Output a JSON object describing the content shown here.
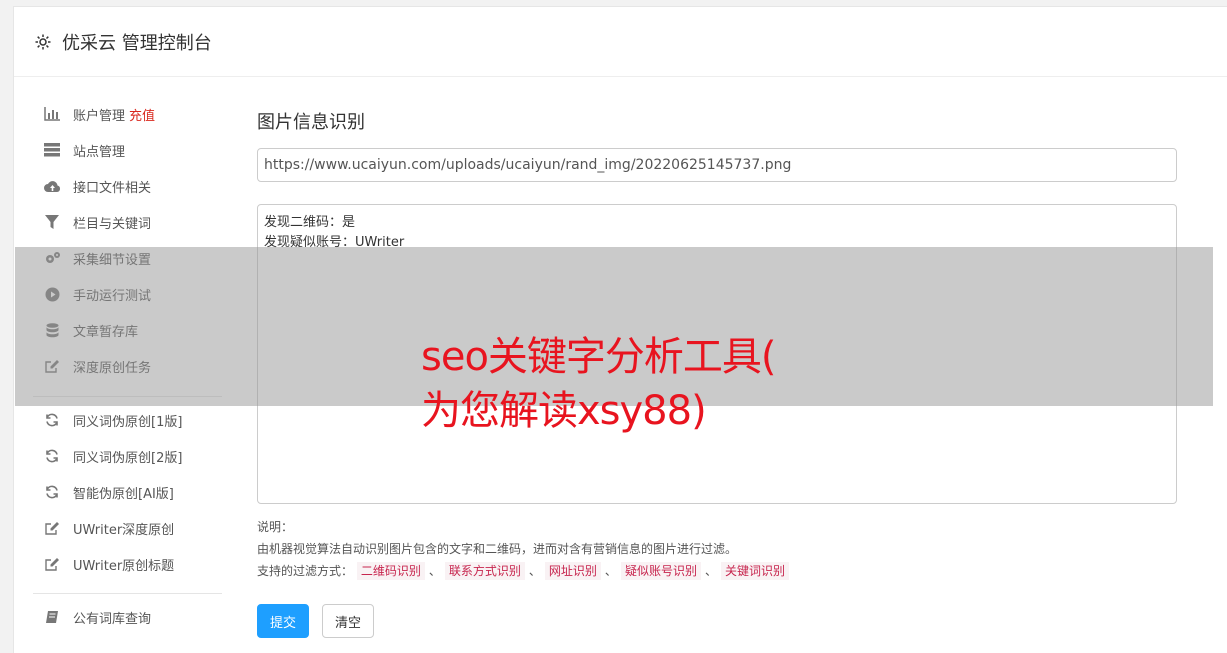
{
  "header": {
    "title": "优采云 管理控制台"
  },
  "sidebar": {
    "group1": [
      {
        "label": "账户管理",
        "badge": "充值",
        "icon": "bar-chart-icon"
      },
      {
        "label": "站点管理",
        "icon": "server-icon"
      },
      {
        "label": "接口文件相关",
        "icon": "cloud-upload-icon"
      },
      {
        "label": "栏目与关键词",
        "icon": "filter-icon"
      },
      {
        "label": "采集细节设置",
        "icon": "gears-icon"
      },
      {
        "label": "手动运行测试",
        "icon": "play-circle-icon"
      },
      {
        "label": "文章暂存库",
        "icon": "database-icon"
      },
      {
        "label": "深度原创任务",
        "icon": "edit-icon"
      }
    ],
    "group2": [
      {
        "label": "同义词伪原创[1版]",
        "icon": "refresh-icon"
      },
      {
        "label": "同义词伪原创[2版]",
        "icon": "refresh-icon"
      },
      {
        "label": "智能伪原创[AI版]",
        "icon": "refresh-icon"
      },
      {
        "label": "UWriter深度原创",
        "icon": "edit-icon"
      },
      {
        "label": "UWriter原创标题",
        "icon": "edit-icon"
      }
    ],
    "group3": [
      {
        "label": "公有词库查询",
        "icon": "book-icon"
      }
    ]
  },
  "main": {
    "title": "图片信息识别",
    "url_value": "https://www.ucaiyun.com/uploads/ucaiyun/rand_img/20220625145737.png",
    "result_text": "发现二维码：是\n发现疑似账号：UWriter",
    "notes": {
      "label": "说明：",
      "desc": "由机器视觉算法自动识别图片包含的文字和二维码，进而对含有营销信息的图片进行过滤。",
      "filters_label": "支持的过滤方式：",
      "filters": [
        "二维码识别",
        "联系方式识别",
        "网址识别",
        "疑似账号识别",
        "关键词识别"
      ],
      "separator": "、"
    },
    "submit_label": "提交",
    "clear_label": "清空"
  },
  "overlay": {
    "line1": "seo关键字分析工具(",
    "line2": "为您解读xsy88)"
  },
  "colors": {
    "accent": "#1e9fff",
    "recharge": "#d9281e",
    "tag_text": "#c7254e",
    "overlay_text": "#e8141f"
  }
}
